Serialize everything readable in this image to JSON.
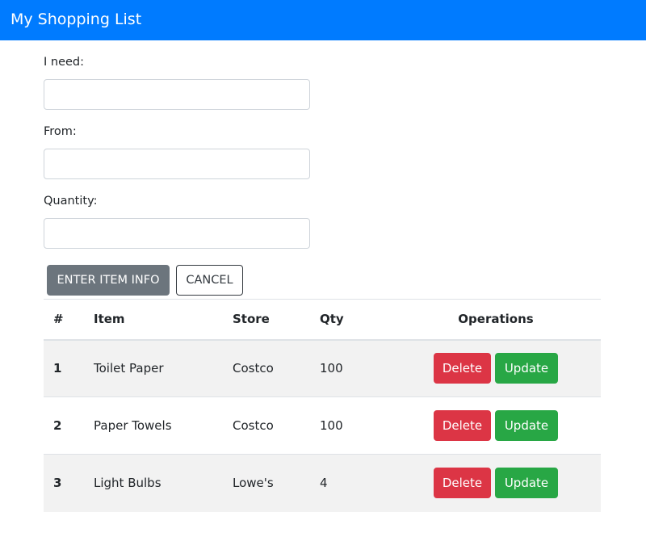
{
  "navbar": {
    "title": "My Shopping List"
  },
  "form": {
    "need": {
      "label": "I need:",
      "value": "",
      "placeholder": ""
    },
    "from": {
      "label": "From:",
      "value": "",
      "placeholder": ""
    },
    "quantity": {
      "label": "Quantity:",
      "value": "",
      "placeholder": ""
    },
    "enter_label": "ENTER ITEM INFO",
    "cancel_label": "CANCEL"
  },
  "table": {
    "headers": {
      "num": "#",
      "item": "Item",
      "store": "Store",
      "qty": "Qty",
      "operations": "Operations"
    },
    "rows": [
      {
        "num": "1",
        "item": "Toilet Paper",
        "store": "Costco",
        "qty": "100",
        "delete_label": "Delete",
        "update_label": "Update"
      },
      {
        "num": "2",
        "item": "Paper Towels",
        "store": "Costco",
        "qty": "100",
        "delete_label": "Delete",
        "update_label": "Update"
      },
      {
        "num": "3",
        "item": "Light Bulbs",
        "store": "Lowe's",
        "qty": "4",
        "delete_label": "Delete",
        "update_label": "Update"
      }
    ]
  },
  "colors": {
    "navbar": "#007bff",
    "enter_button": "#6c757d",
    "delete_button": "#dc3545",
    "update_button": "#28a745",
    "row_stripe": "#f2f2f2"
  }
}
